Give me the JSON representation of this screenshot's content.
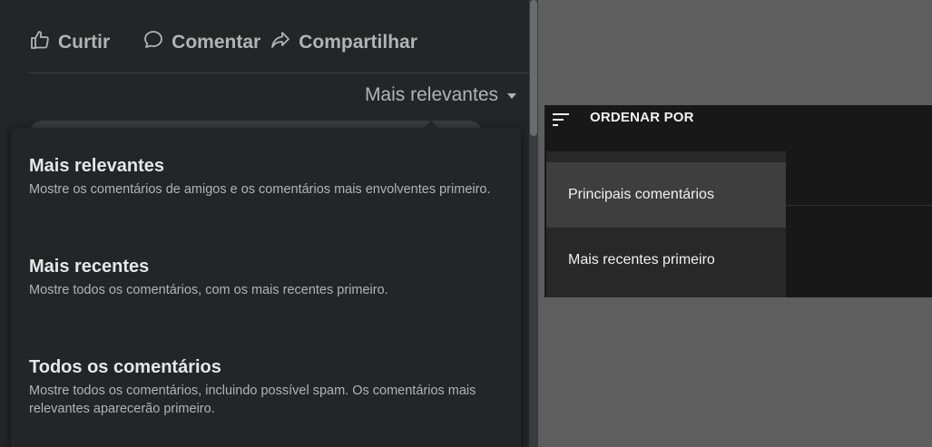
{
  "facebook": {
    "actions": [
      {
        "label": "Curtir",
        "icon": "thumbs-up-icon"
      },
      {
        "label": "Comentar",
        "icon": "comment-icon"
      },
      {
        "label": "Compartilhar",
        "icon": "share-icon"
      }
    ],
    "sort_selected": "Mais relevantes",
    "sort_options": [
      {
        "title": "Mais relevantes",
        "description": "Mostre os comentários de amigos e os comentários mais envolventes primeiro."
      },
      {
        "title": "Mais recentes",
        "description": "Mostre todos os comentários, com os mais recentes primeiro."
      },
      {
        "title": "Todos os comentários",
        "description": "Mostre todos os comentários, incluindo possível spam. Os comentários mais relevantes aparecerão primeiro."
      }
    ]
  },
  "youtube": {
    "header_label": "ORDENAR POR",
    "header_icon": "sort-icon",
    "options": [
      {
        "label": "Principais comentários",
        "active": true
      },
      {
        "label": "Mais recentes primeiro",
        "active": false
      }
    ]
  },
  "colors": {
    "fb_panel_bg": "#242526",
    "fb_text_primary": "#e4e6eb",
    "fb_text_secondary": "#b0b3b8",
    "yt_bar_bg": "#181818",
    "yt_menu_bg": "#282828",
    "yt_item_active_bg": "#3e3e3e",
    "page_bg": "#5e5e5e"
  }
}
